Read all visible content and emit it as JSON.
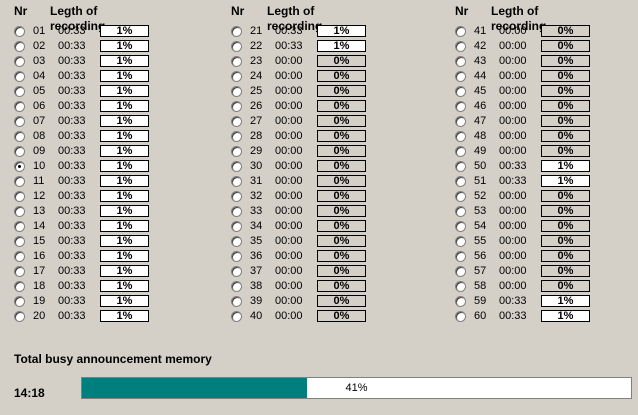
{
  "headers": {
    "nr": "Nr",
    "length": "Legth of recording"
  },
  "columns": [
    {
      "rows": [
        {
          "nr": "01",
          "time": "00:33",
          "pct": "1%",
          "recorded": true,
          "selected": false
        },
        {
          "nr": "02",
          "time": "00:33",
          "pct": "1%",
          "recorded": true,
          "selected": false
        },
        {
          "nr": "03",
          "time": "00:33",
          "pct": "1%",
          "recorded": true,
          "selected": false
        },
        {
          "nr": "04",
          "time": "00:33",
          "pct": "1%",
          "recorded": true,
          "selected": false
        },
        {
          "nr": "05",
          "time": "00:33",
          "pct": "1%",
          "recorded": true,
          "selected": false
        },
        {
          "nr": "06",
          "time": "00:33",
          "pct": "1%",
          "recorded": true,
          "selected": false
        },
        {
          "nr": "07",
          "time": "00:33",
          "pct": "1%",
          "recorded": true,
          "selected": false
        },
        {
          "nr": "08",
          "time": "00:33",
          "pct": "1%",
          "recorded": true,
          "selected": false
        },
        {
          "nr": "09",
          "time": "00:33",
          "pct": "1%",
          "recorded": true,
          "selected": false
        },
        {
          "nr": "10",
          "time": "00:33",
          "pct": "1%",
          "recorded": true,
          "selected": true
        },
        {
          "nr": "11",
          "time": "00:33",
          "pct": "1%",
          "recorded": true,
          "selected": false
        },
        {
          "nr": "12",
          "time": "00:33",
          "pct": "1%",
          "recorded": true,
          "selected": false
        },
        {
          "nr": "13",
          "time": "00:33",
          "pct": "1%",
          "recorded": true,
          "selected": false
        },
        {
          "nr": "14",
          "time": "00:33",
          "pct": "1%",
          "recorded": true,
          "selected": false
        },
        {
          "nr": "15",
          "time": "00:33",
          "pct": "1%",
          "recorded": true,
          "selected": false
        },
        {
          "nr": "16",
          "time": "00:33",
          "pct": "1%",
          "recorded": true,
          "selected": false
        },
        {
          "nr": "17",
          "time": "00:33",
          "pct": "1%",
          "recorded": true,
          "selected": false
        },
        {
          "nr": "18",
          "time": "00:33",
          "pct": "1%",
          "recorded": true,
          "selected": false
        },
        {
          "nr": "19",
          "time": "00:33",
          "pct": "1%",
          "recorded": true,
          "selected": false
        },
        {
          "nr": "20",
          "time": "00:33",
          "pct": "1%",
          "recorded": true,
          "selected": false
        }
      ]
    },
    {
      "rows": [
        {
          "nr": "21",
          "time": "00:33",
          "pct": "1%",
          "recorded": true,
          "selected": false
        },
        {
          "nr": "22",
          "time": "00:33",
          "pct": "1%",
          "recorded": true,
          "selected": false
        },
        {
          "nr": "23",
          "time": "00:00",
          "pct": "0%",
          "recorded": false,
          "selected": false
        },
        {
          "nr": "24",
          "time": "00:00",
          "pct": "0%",
          "recorded": false,
          "selected": false
        },
        {
          "nr": "25",
          "time": "00:00",
          "pct": "0%",
          "recorded": false,
          "selected": false
        },
        {
          "nr": "26",
          "time": "00:00",
          "pct": "0%",
          "recorded": false,
          "selected": false
        },
        {
          "nr": "27",
          "time": "00:00",
          "pct": "0%",
          "recorded": false,
          "selected": false
        },
        {
          "nr": "28",
          "time": "00:00",
          "pct": "0%",
          "recorded": false,
          "selected": false
        },
        {
          "nr": "29",
          "time": "00:00",
          "pct": "0%",
          "recorded": false,
          "selected": false
        },
        {
          "nr": "30",
          "time": "00:00",
          "pct": "0%",
          "recorded": false,
          "selected": false
        },
        {
          "nr": "31",
          "time": "00:00",
          "pct": "0%",
          "recorded": false,
          "selected": false
        },
        {
          "nr": "32",
          "time": "00:00",
          "pct": "0%",
          "recorded": false,
          "selected": false
        },
        {
          "nr": "33",
          "time": "00:00",
          "pct": "0%",
          "recorded": false,
          "selected": false
        },
        {
          "nr": "34",
          "time": "00:00",
          "pct": "0%",
          "recorded": false,
          "selected": false
        },
        {
          "nr": "35",
          "time": "00:00",
          "pct": "0%",
          "recorded": false,
          "selected": false
        },
        {
          "nr": "36",
          "time": "00:00",
          "pct": "0%",
          "recorded": false,
          "selected": false
        },
        {
          "nr": "37",
          "time": "00:00",
          "pct": "0%",
          "recorded": false,
          "selected": false
        },
        {
          "nr": "38",
          "time": "00:00",
          "pct": "0%",
          "recorded": false,
          "selected": false
        },
        {
          "nr": "39",
          "time": "00:00",
          "pct": "0%",
          "recorded": false,
          "selected": false
        },
        {
          "nr": "40",
          "time": "00:00",
          "pct": "0%",
          "recorded": false,
          "selected": false
        }
      ]
    },
    {
      "rows": [
        {
          "nr": "41",
          "time": "00:00",
          "pct": "0%",
          "recorded": false,
          "selected": false
        },
        {
          "nr": "42",
          "time": "00:00",
          "pct": "0%",
          "recorded": false,
          "selected": false
        },
        {
          "nr": "43",
          "time": "00:00",
          "pct": "0%",
          "recorded": false,
          "selected": false
        },
        {
          "nr": "44",
          "time": "00:00",
          "pct": "0%",
          "recorded": false,
          "selected": false
        },
        {
          "nr": "45",
          "time": "00:00",
          "pct": "0%",
          "recorded": false,
          "selected": false
        },
        {
          "nr": "46",
          "time": "00:00",
          "pct": "0%",
          "recorded": false,
          "selected": false
        },
        {
          "nr": "47",
          "time": "00:00",
          "pct": "0%",
          "recorded": false,
          "selected": false
        },
        {
          "nr": "48",
          "time": "00:00",
          "pct": "0%",
          "recorded": false,
          "selected": false
        },
        {
          "nr": "49",
          "time": "00:00",
          "pct": "0%",
          "recorded": false,
          "selected": false
        },
        {
          "nr": "50",
          "time": "00:33",
          "pct": "1%",
          "recorded": true,
          "selected": false
        },
        {
          "nr": "51",
          "time": "00:33",
          "pct": "1%",
          "recorded": true,
          "selected": false
        },
        {
          "nr": "52",
          "time": "00:00",
          "pct": "0%",
          "recorded": false,
          "selected": false
        },
        {
          "nr": "53",
          "time": "00:00",
          "pct": "0%",
          "recorded": false,
          "selected": false
        },
        {
          "nr": "54",
          "time": "00:00",
          "pct": "0%",
          "recorded": false,
          "selected": false
        },
        {
          "nr": "55",
          "time": "00:00",
          "pct": "0%",
          "recorded": false,
          "selected": false
        },
        {
          "nr": "56",
          "time": "00:00",
          "pct": "0%",
          "recorded": false,
          "selected": false
        },
        {
          "nr": "57",
          "time": "00:00",
          "pct": "0%",
          "recorded": false,
          "selected": false
        },
        {
          "nr": "58",
          "time": "00:00",
          "pct": "0%",
          "recorded": false,
          "selected": false
        },
        {
          "nr": "59",
          "time": "00:33",
          "pct": "1%",
          "recorded": true,
          "selected": false
        },
        {
          "nr": "60",
          "time": "00:33",
          "pct": "1%",
          "recorded": true,
          "selected": false
        }
      ]
    }
  ],
  "memory": {
    "title": "Total busy announcement memory",
    "total_time": "14:18",
    "percent_label": "41%",
    "percent_value": 41,
    "fill_color": "#007f7f"
  }
}
